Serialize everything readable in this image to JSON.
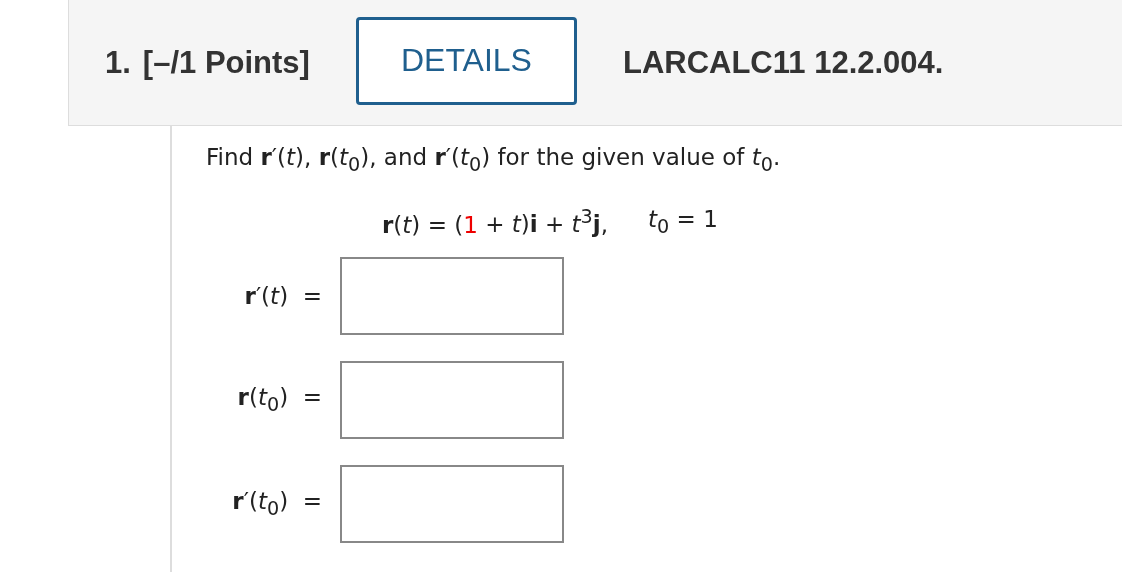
{
  "question": {
    "number": "1.",
    "points": "[–/1 Points]",
    "details_button": "DETAILS",
    "code": "LARCALC11 12.2.004."
  },
  "prompt": "Find **r**′(*t*), **r**(*t*$_{0}$), and **r**′(*t*$_{0}$) for the given value of *t*$_{0}$.",
  "formula": [
    {
      "text": "**r**(*t*) = (",
      "highlighted": false
    },
    {
      "text": "1",
      "highlighted": true
    },
    {
      "text": " + *t*)**i** + *t*$^{3}$**j**,",
      "highlighted": false
    }
  ],
  "condition": "*t*$_{0}$ = 1",
  "answers": [
    {
      "label": "**r**′(*t*)  ="
    },
    {
      "label": "**r**(*t*$_{0}$)  ="
    },
    {
      "label": "**r**′(*t*$_{0}$)  ="
    }
  ]
}
